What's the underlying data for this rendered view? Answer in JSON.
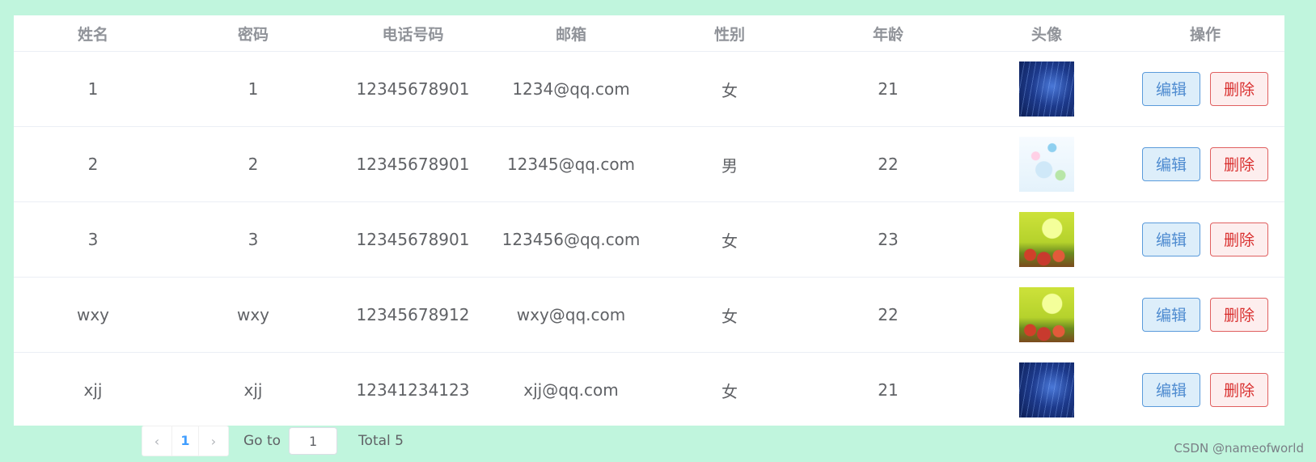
{
  "table": {
    "columns": [
      "姓名",
      "密码",
      "电话号码",
      "邮箱",
      "性别",
      "年龄",
      "头像",
      "操作"
    ],
    "rows": [
      {
        "name": "1",
        "password": "1",
        "phone": "12345678901",
        "email": "1234@qq.com",
        "gender": "女",
        "age": "21",
        "avatar": "avatar-blue-abstract"
      },
      {
        "name": "2",
        "password": "2",
        "phone": "12345678901",
        "email": "12345@qq.com",
        "gender": "男",
        "age": "22",
        "avatar": "avatar-light-floral"
      },
      {
        "name": "3",
        "password": "3",
        "phone": "12345678901",
        "email": "123456@qq.com",
        "gender": "女",
        "age": "23",
        "avatar": "avatar-yellow-flowers"
      },
      {
        "name": "wxy",
        "password": "wxy",
        "phone": "12345678912",
        "email": "wxy@qq.com",
        "gender": "女",
        "age": "22",
        "avatar": "avatar-yellow-flowers"
      },
      {
        "name": "xjj",
        "password": "xjj",
        "phone": "12341234123",
        "email": "xjj@qq.com",
        "gender": "女",
        "age": "21",
        "avatar": "avatar-blue-abstract"
      }
    ],
    "edit_label": "编辑",
    "delete_label": "删除"
  },
  "pagination": {
    "prev_icon": "chevron-left-icon",
    "current_page": "1",
    "next_icon": "chevron-right-icon",
    "goto_label": "Go to",
    "goto_value": "1",
    "total_label": "Total 5"
  },
  "watermark": "CSDN @nameofworld",
  "colors": {
    "background": "#c0f5dd",
    "edit_button": "#4e8bd0",
    "delete_button": "#d9302f",
    "active_page": "#409eff"
  }
}
